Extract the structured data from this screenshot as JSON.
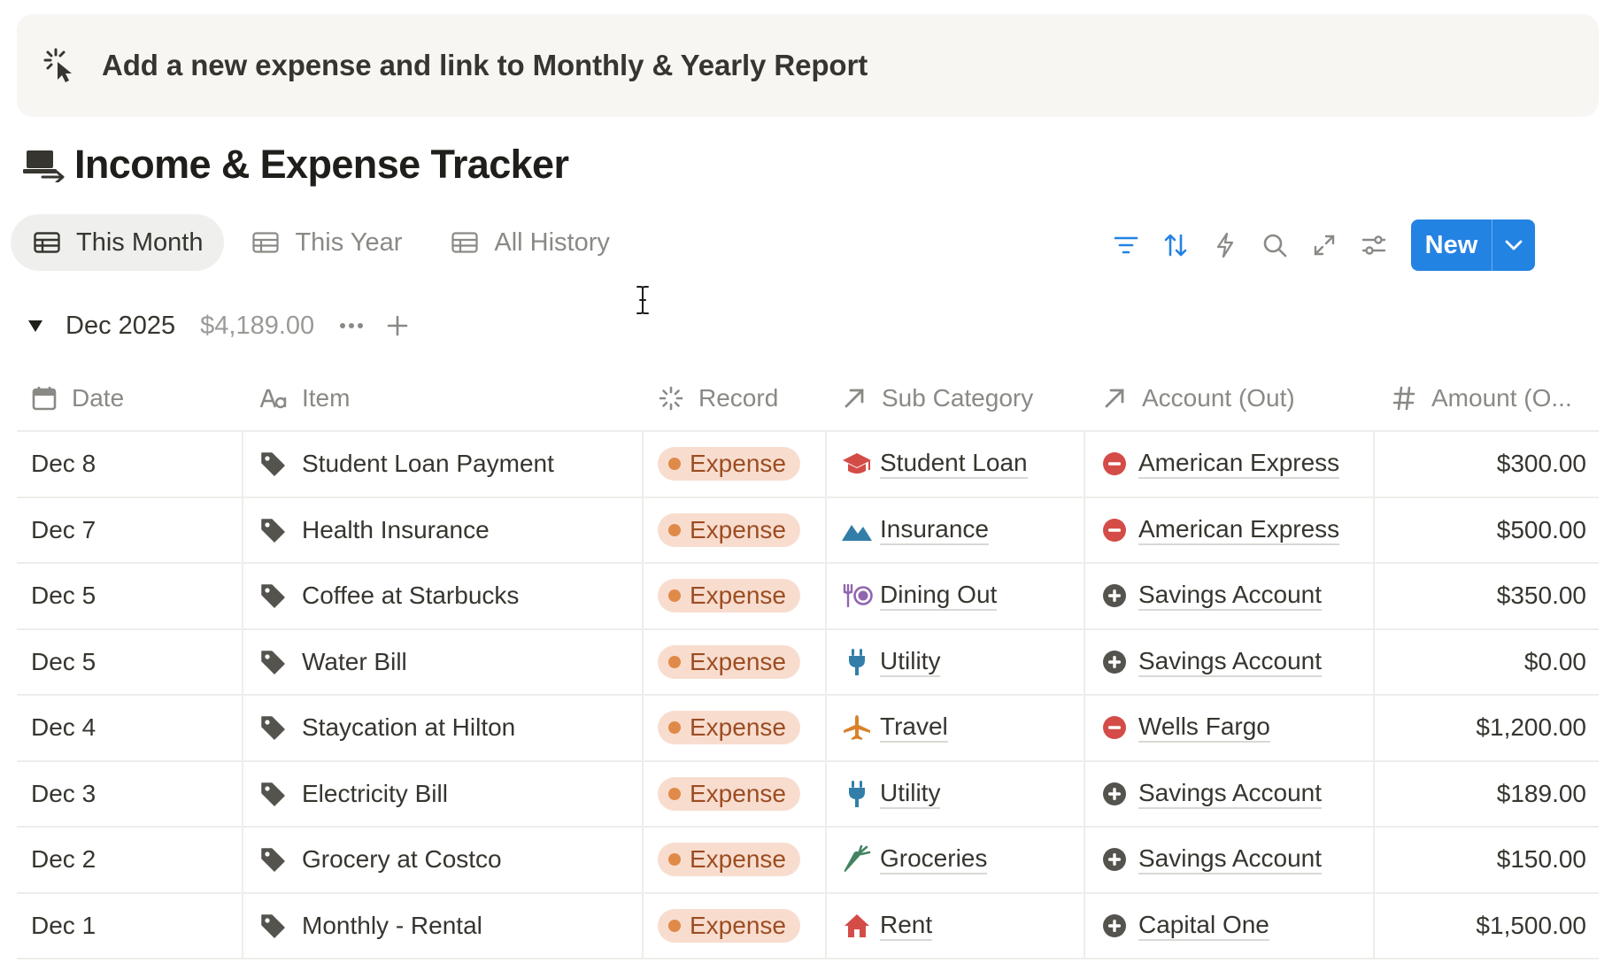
{
  "banner": {
    "text": "Add a new expense and link to Monthly & Yearly Report",
    "icon": "sparkle-cursor-icon"
  },
  "page": {
    "title": "Income & Expense Tracker",
    "icon": "laptop-arrow-icon"
  },
  "tabs": [
    {
      "label": "This Month",
      "icon": "table-icon",
      "active": true
    },
    {
      "label": "This Year",
      "icon": "table-icon",
      "active": false
    },
    {
      "label": "All History",
      "icon": "table-icon",
      "active": false
    }
  ],
  "toolbar": {
    "icons": [
      "filter-icon",
      "sort-icon",
      "lightning-icon",
      "search-icon",
      "expand-icon",
      "settings-sliders-icon"
    ],
    "new_label": "New",
    "accent": "#2383e2"
  },
  "group": {
    "name": "Dec 2025",
    "sum": "$4,189.00"
  },
  "columns": [
    {
      "label": "Date",
      "icon": "calendar-icon"
    },
    {
      "label": "Item",
      "icon": "text-aa-icon"
    },
    {
      "label": "Record",
      "icon": "status-spinner-icon"
    },
    {
      "label": "Sub Category",
      "icon": "relation-arrow-icon"
    },
    {
      "label": "Account (Out)",
      "icon": "relation-arrow-icon"
    },
    {
      "label": "Amount (O...",
      "icon": "hash-icon"
    }
  ],
  "rows": [
    {
      "date": "Dec 8",
      "item": "Student Loan Payment",
      "record": "Expense",
      "sub": "Student Loan",
      "sub_icon": "graduation-cap-icon",
      "account": "American Express",
      "account_icon": "minus-circle-icon",
      "amount": "$300.00"
    },
    {
      "date": "Dec 7",
      "item": "Health Insurance",
      "record": "Expense",
      "sub": "Insurance",
      "sub_icon": "mountain-icon",
      "account": "American Express",
      "account_icon": "minus-circle-icon",
      "amount": "$500.00"
    },
    {
      "date": "Dec 5",
      "item": "Coffee at Starbucks",
      "record": "Expense",
      "sub": "Dining Out",
      "sub_icon": "fork-plate-icon",
      "account": "Savings Account",
      "account_icon": "plus-circle-icon",
      "amount": "$350.00"
    },
    {
      "date": "Dec 5",
      "item": "Water Bill",
      "record": "Expense",
      "sub": "Utility",
      "sub_icon": "plug-icon",
      "account": "Savings Account",
      "account_icon": "plus-circle-icon",
      "amount": "$0.00"
    },
    {
      "date": "Dec 4",
      "item": "Staycation at Hilton",
      "record": "Expense",
      "sub": "Travel",
      "sub_icon": "airplane-icon",
      "account": "Wells Fargo",
      "account_icon": "minus-circle-icon",
      "amount": "$1,200.00"
    },
    {
      "date": "Dec 3",
      "item": "Electricity Bill",
      "record": "Expense",
      "sub": "Utility",
      "sub_icon": "plug-icon",
      "account": "Savings Account",
      "account_icon": "plus-circle-icon",
      "amount": "$189.00"
    },
    {
      "date": "Dec 2",
      "item": "Grocery at Costco",
      "record": "Expense",
      "sub": "Groceries",
      "sub_icon": "carrot-icon",
      "account": "Savings Account",
      "account_icon": "plus-circle-icon",
      "amount": "$150.00"
    },
    {
      "date": "Dec 1",
      "item": "Monthly - Rental",
      "record": "Expense",
      "sub": "Rent",
      "sub_icon": "house-icon",
      "account": "Capital One",
      "account_icon": "plus-circle-icon",
      "amount": "$1,500.00"
    }
  ]
}
